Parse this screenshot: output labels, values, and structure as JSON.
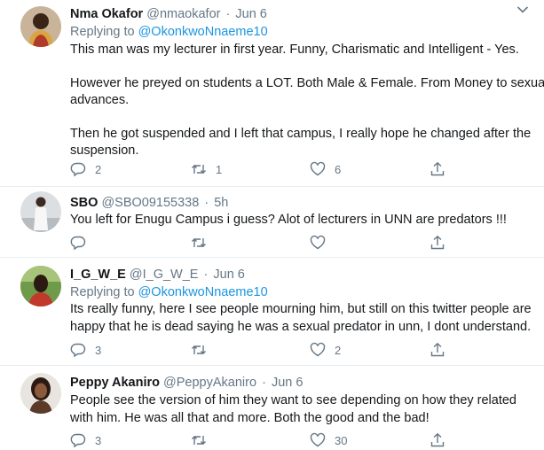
{
  "tweets": [
    {
      "name": "Nma Okafor",
      "handle": "@nmaokafor",
      "time": "Jun 6",
      "replying_prefix": "Replying to ",
      "replying_to": "@OkonkwoNnaeme10",
      "lines": [
        "This man was my lecturer in first year. Funny, Charismatic and Intelligent - Yes.",
        "However he preyed on students a LOT. Both Male & Female. From Money to sexual",
        "advances.",
        "Then he got suspended and I left that campus, I really hope he changed after the",
        "suspension."
      ],
      "replies": "2",
      "retweets": "1",
      "likes": "6"
    },
    {
      "name": "SBO",
      "handle": "@SBO09155338",
      "time": "5h",
      "lines": [
        "You left for Enugu Campus i guess? Alot of lecturers in UNN are predators !!!"
      ]
    },
    {
      "name": "I_G_W_E",
      "handle": "@I_G_W_E",
      "time": "Jun 6",
      "replying_prefix": "Replying to ",
      "replying_to": "@OkonkwoNnaeme10",
      "lines": [
        "Its really funny, here I see people mourning him, but still on this twitter  people are",
        "happy that he is dead saying he was a sexual predator in unn, I dont understand."
      ],
      "replies": "3",
      "likes": "2"
    },
    {
      "name": "Peppy Akaniro",
      "handle": "@PeppyAkaniro",
      "time": "Jun 6",
      "lines": [
        "People see the version of him they want to see depending on how they related",
        "with him. He was all that and more. Both the good and the bad!"
      ],
      "replies": "3",
      "likes": "30"
    }
  ],
  "icons": {
    "reply": "reply-icon",
    "retweet": "retweet-icon",
    "like": "heart-icon",
    "share": "share-icon",
    "menu": "chevron-down-icon"
  },
  "colors": {
    "text": "#14171a",
    "secondary": "#657786",
    "link": "#1b95e0",
    "divider": "#e6ecf0"
  },
  "symbols": {
    "separator": "·"
  }
}
